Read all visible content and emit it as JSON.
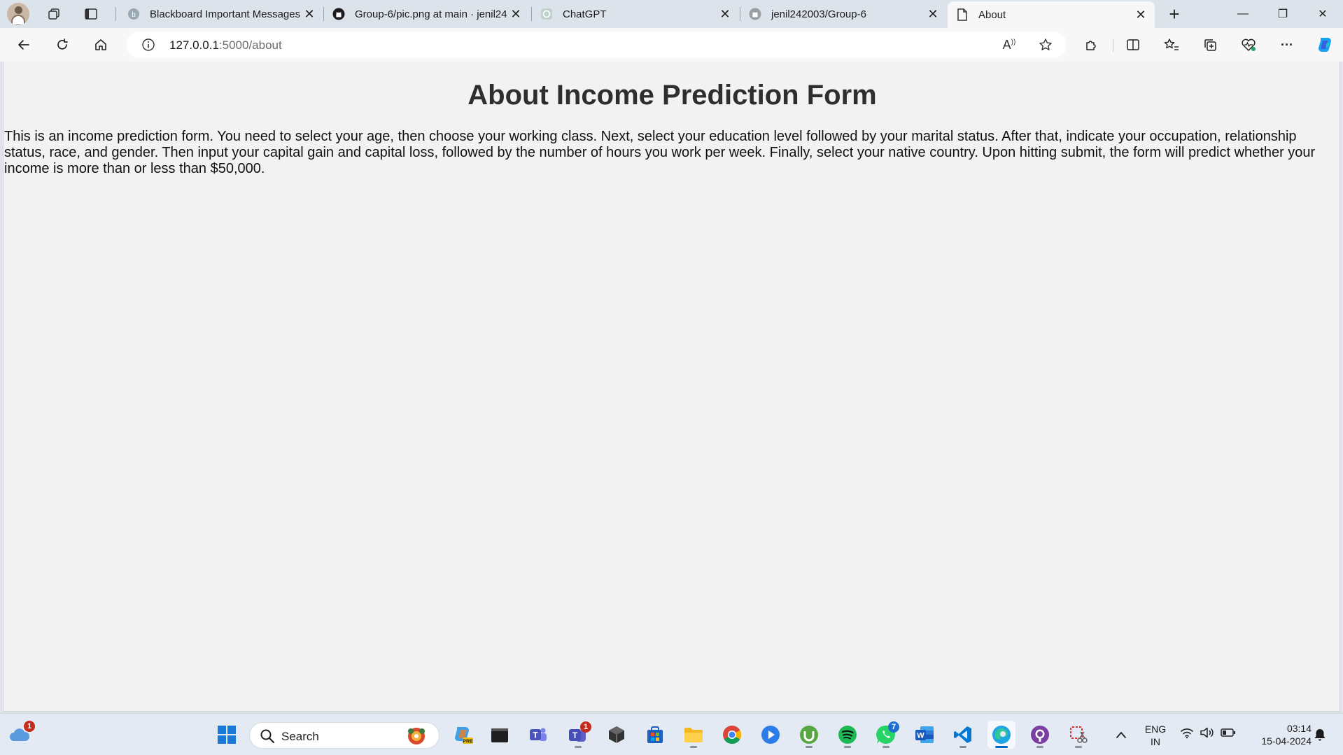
{
  "browser": {
    "tabs": [
      {
        "label": "Blackboard Important Messages",
        "icon": "blackboard-icon",
        "active": false
      },
      {
        "label": "Group-6/pic.png at main · jenil24",
        "icon": "github-icon",
        "active": false
      },
      {
        "label": "ChatGPT",
        "icon": "chatgpt-icon",
        "active": false
      },
      {
        "label": "jenil242003/Group-6",
        "icon": "github-icon",
        "active": false
      },
      {
        "label": "About",
        "icon": "page-icon",
        "active": true
      }
    ],
    "close_glyph": "✕",
    "new_tab_glyph": "+",
    "window_controls": {
      "minimize": "—",
      "maximize": "❐",
      "close": "✕"
    },
    "address": {
      "host": "127.0.0.1",
      "path": ":5000/about"
    },
    "read_aloud_glyph": "A",
    "more_glyph": "···"
  },
  "page": {
    "title": "About Income Prediction Form",
    "description": "This is an income prediction form. You need to select your age, then choose your working class. Next, select your education level followed by your marital status. After that, indicate your occupation, relationship status, race, and gender. Then input your capital gain and capital loss, followed by the number of hours you work per week. Finally, select your native country. Upon hitting submit, the form will predict whether your income is more than or less than $50,000."
  },
  "taskbar": {
    "search_label": "Search",
    "weather_badge": "1",
    "teams_badge": "1",
    "whatsapp_badge": "7",
    "language": {
      "line1": "ENG",
      "line2": "IN"
    },
    "clock": {
      "time": "03:14",
      "date": "15-04-2024"
    },
    "accent": "#0067c0"
  }
}
